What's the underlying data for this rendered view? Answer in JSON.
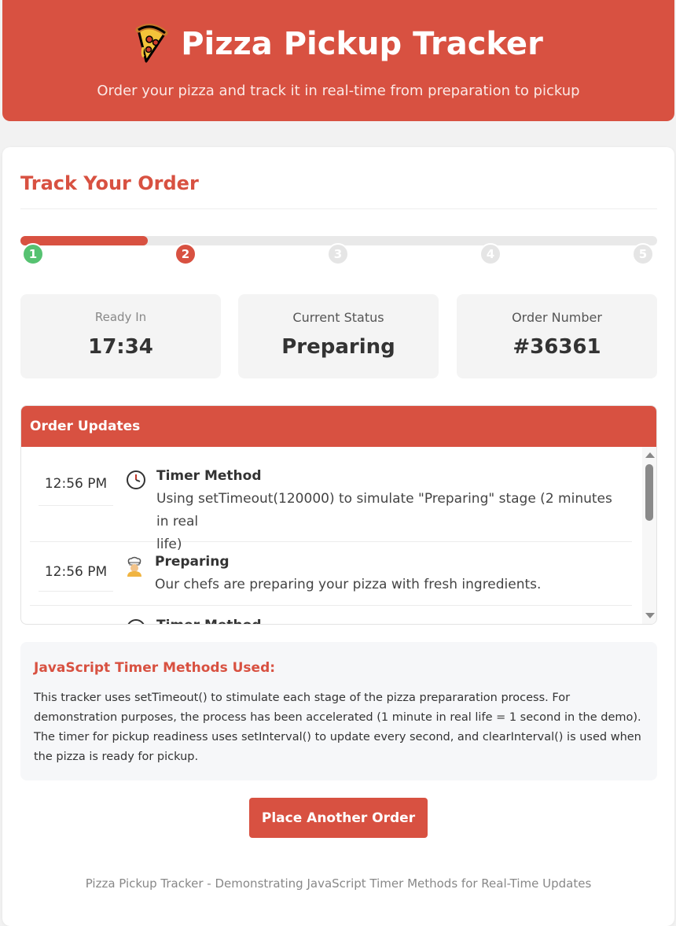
{
  "header": {
    "title": "Pizza Pickup Tracker",
    "subtitle": "Order your pizza and track it in real-time from preparation to pickup",
    "icon": "pizza-icon"
  },
  "tracker": {
    "title": "Track Your Order",
    "progress_percent": 20,
    "steps": [
      {
        "label": "1",
        "state": "done"
      },
      {
        "label": "2",
        "state": "active"
      },
      {
        "label": "3",
        "state": "pending"
      },
      {
        "label": "4",
        "state": "pending"
      },
      {
        "label": "5",
        "state": "pending"
      }
    ]
  },
  "stats": {
    "ready_in": {
      "label": "Ready In",
      "value": "17:34"
    },
    "status": {
      "label": "Current Status",
      "value": "Preparing"
    },
    "order": {
      "label": "Order Number",
      "value": "#36361"
    }
  },
  "updates": {
    "title": "Order Updates",
    "items": [
      {
        "time": "12:56 PM",
        "icon": "clock-icon",
        "title": "Timer Method",
        "text_line1": "Using setTimeout(120000) to simulate \"Preparing\" stage (2 minutes in real",
        "text_line2": "life)"
      },
      {
        "time": "12:56 PM",
        "icon": "chef-icon",
        "title": "Preparing",
        "text_line1": "Our chefs are preparing your pizza with fresh ingredients."
      },
      {
        "title": "Timer Method",
        "icon": "clock-icon"
      }
    ]
  },
  "info": {
    "title": "JavaScript Timer Methods Used:",
    "text": "This tracker uses setTimeout() to stimulate each stage of the pizza prepararation process. For demonstration purposes, the process has been accelerated (1 minute in real life = 1 second in the demo). The timer for pickup readiness uses setInterval() to update every second, and clearInterval() is used when the pizza is ready for pickup."
  },
  "actions": {
    "place_order_label": "Place Another Order"
  },
  "footer": {
    "text": "Pizza Pickup Tracker - Demonstrating JavaScript Timer Methods for Real-Time Updates"
  },
  "colors": {
    "brand": "#d85141",
    "done": "#56c271",
    "pending": "#e5e5e5"
  }
}
